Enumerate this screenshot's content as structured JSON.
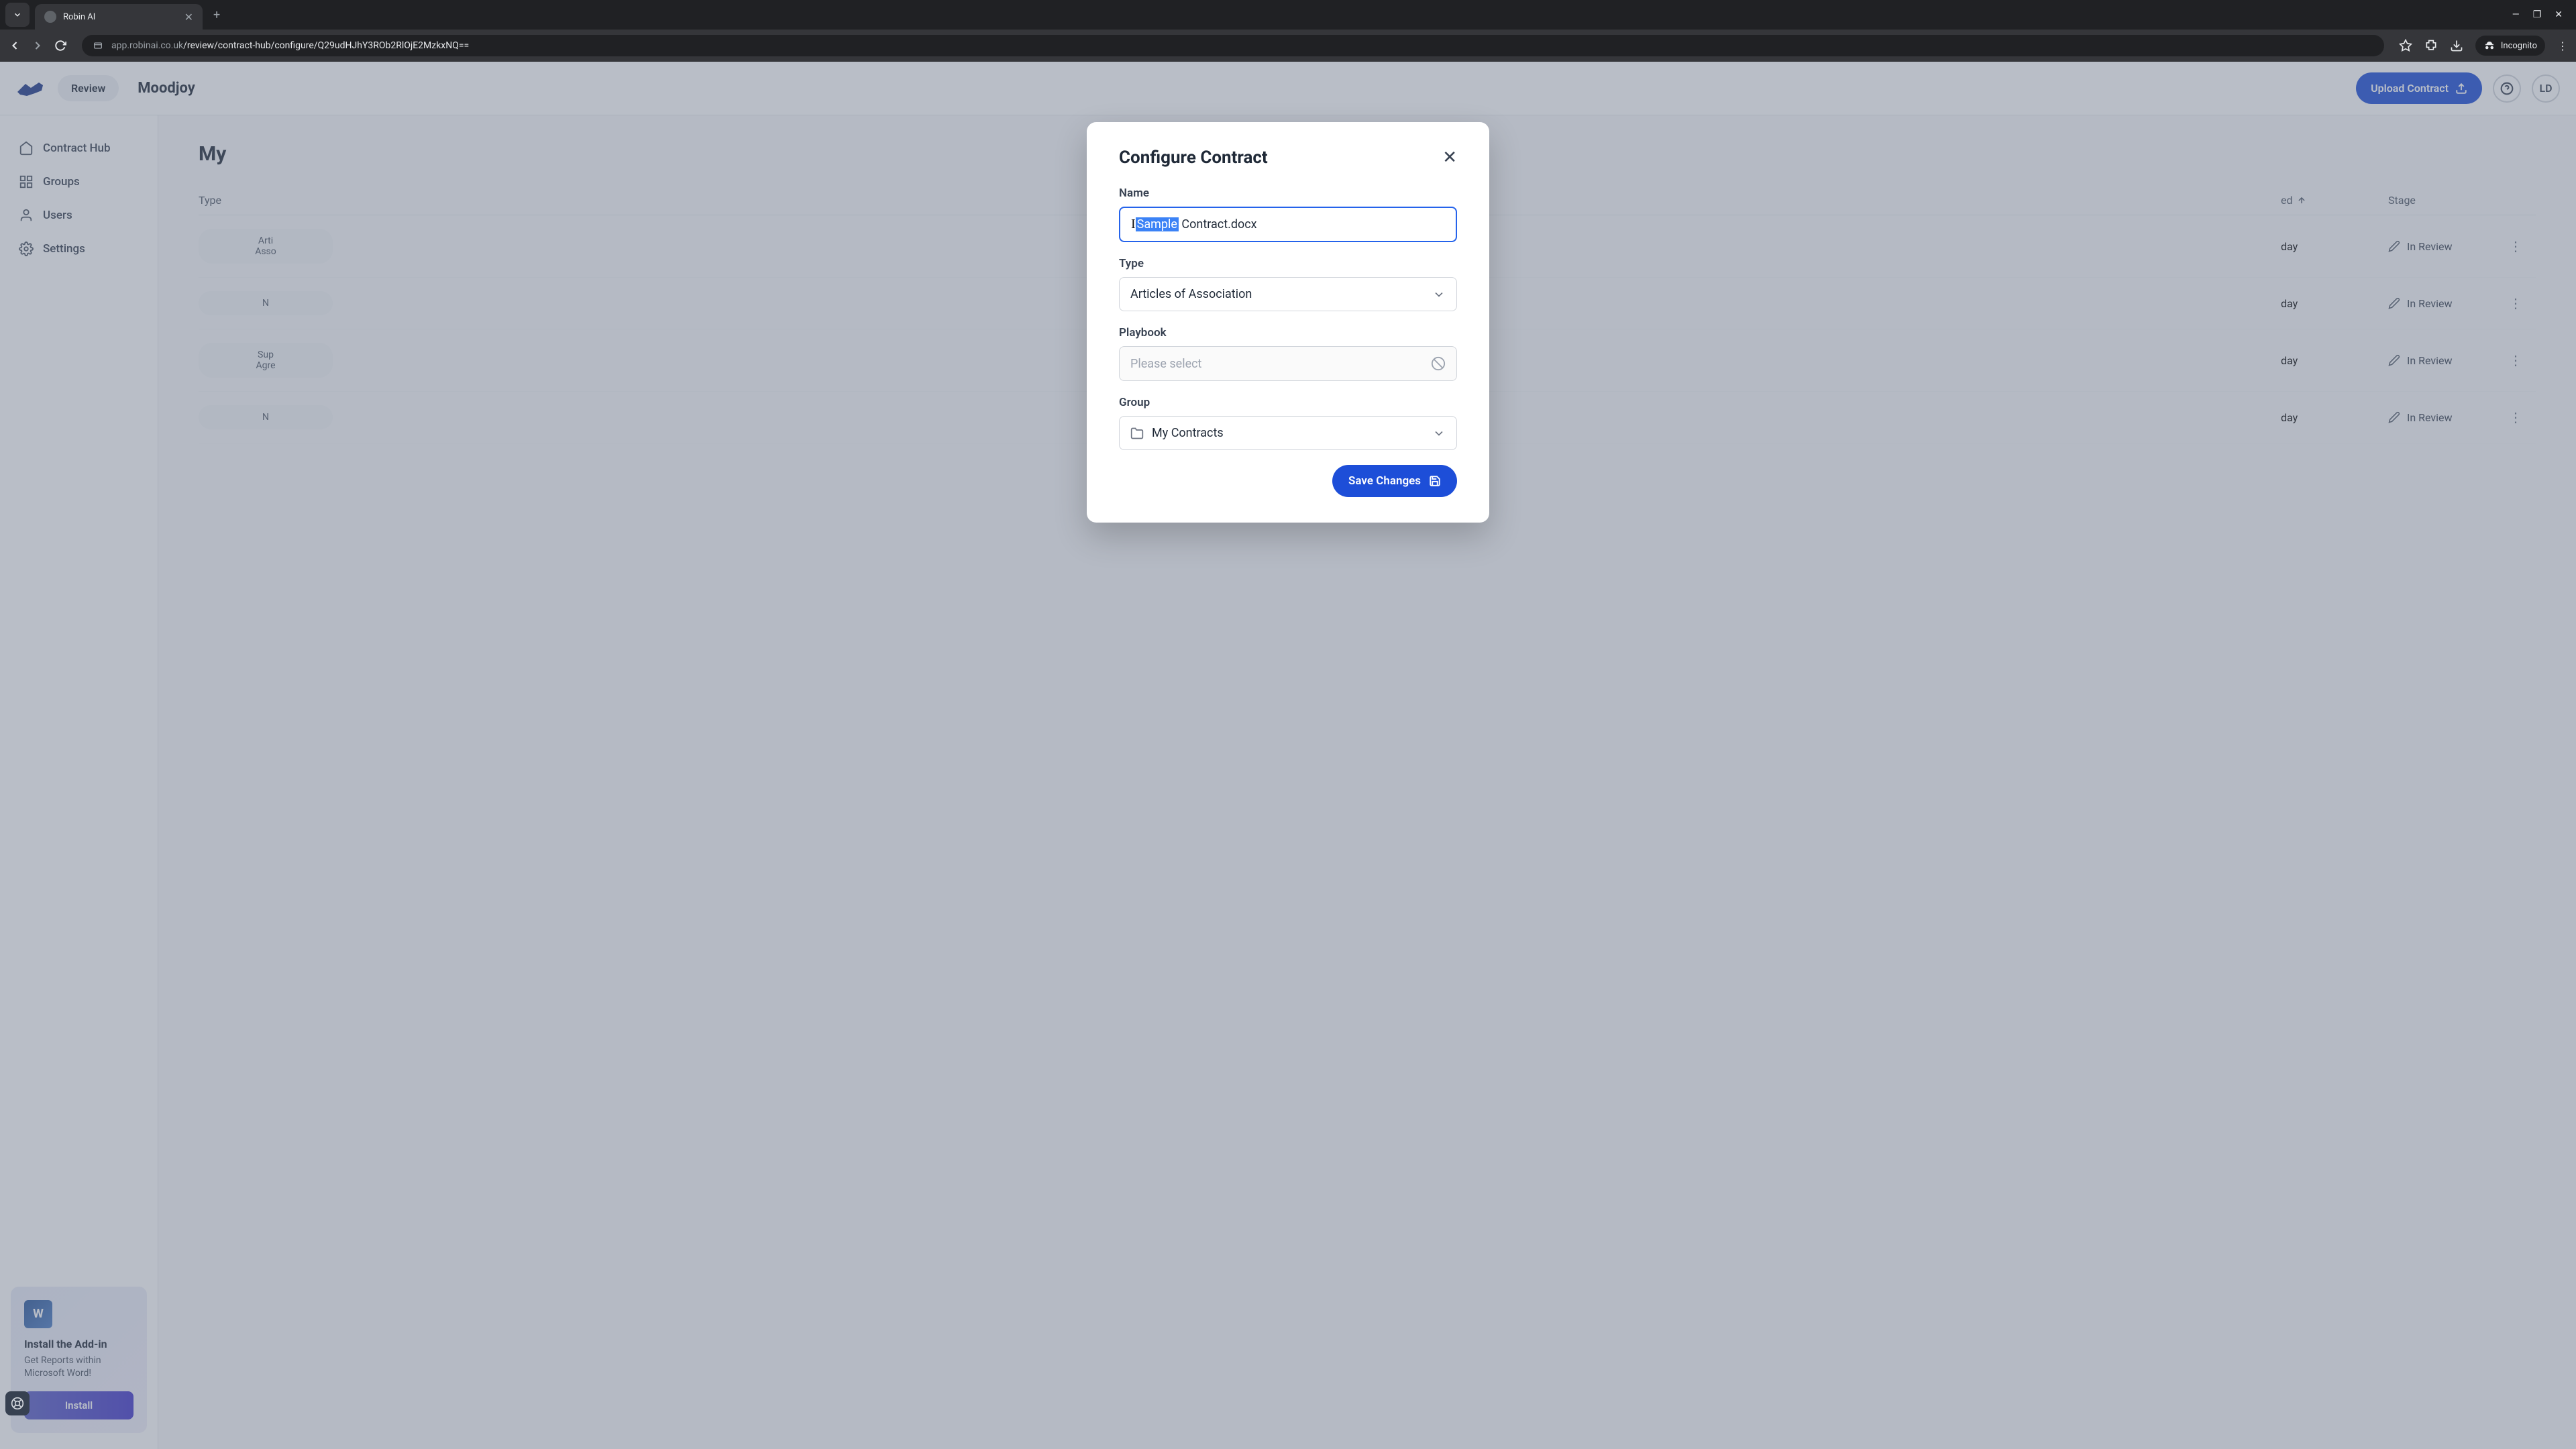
{
  "browser": {
    "tab_title": "Robin AI",
    "url_path": "/review/contract-hub/configure/Q29udHJhY3ROb2RlOjE2MzkxNQ==",
    "url_host": "app.robinai.co.uk",
    "incognito_label": "Incognito"
  },
  "header": {
    "review_label": "Review",
    "workspace": "Moodjoy",
    "upload_label": "Upload Contract",
    "avatar_initials": "LD"
  },
  "sidebar": {
    "items": [
      {
        "label": "Contract Hub"
      },
      {
        "label": "Groups"
      },
      {
        "label": "Users"
      },
      {
        "label": "Settings"
      }
    ],
    "addin": {
      "title": "Install the Add-in",
      "desc": "Get Reports within Microsoft Word!",
      "button": "Install"
    }
  },
  "main": {
    "title_prefix": "My",
    "columns": {
      "type": "Type",
      "date": "ed",
      "stage": "Stage"
    },
    "rows": [
      {
        "type_l1": "Arti",
        "type_l2": "Asso",
        "date": "day",
        "stage": "In Review"
      },
      {
        "type_l1": "N",
        "type_l2": "",
        "date": "day",
        "stage": "In Review"
      },
      {
        "type_l1": "Sup",
        "type_l2": "Agre",
        "date": "day",
        "stage": "In Review"
      },
      {
        "type_l1": "N",
        "type_l2": "",
        "date": "day",
        "stage": "In Review"
      }
    ]
  },
  "modal": {
    "title": "Configure Contract",
    "name_label": "Name",
    "name_selected": "Sample",
    "name_rest": " Contract.docx",
    "type_label": "Type",
    "type_value": "Articles of Association",
    "playbook_label": "Playbook",
    "playbook_placeholder": "Please select",
    "group_label": "Group",
    "group_value": "My Contracts",
    "save_label": "Save Changes"
  }
}
